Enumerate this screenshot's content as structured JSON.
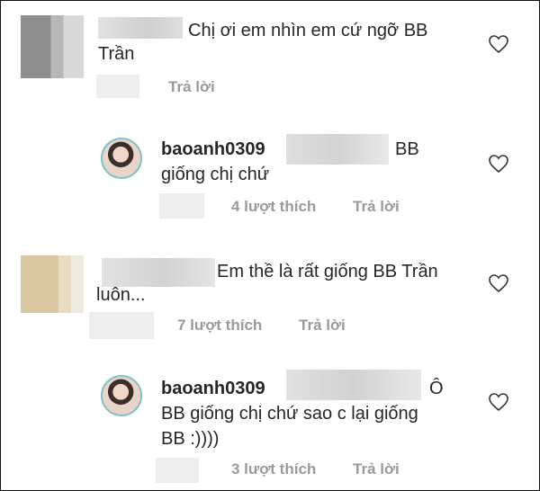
{
  "comments": [
    {
      "text_line1": "Chị ơi em nhìn em cứ ngỡ BB",
      "text_line2": "Trần",
      "reply_label": "Trả lời"
    },
    {
      "username": "baoanh0309",
      "text_line1_end": "BB",
      "text_line2": "giống chị chứ",
      "likes_label": "4 lượt thích",
      "reply_label": "Trả lời"
    },
    {
      "text_line1": "Em thề là rất giống BB Trần",
      "text_line2": "luôn...",
      "likes_label": "7 lượt thích",
      "reply_label": "Trả lời"
    },
    {
      "username": "baoanh0309",
      "text_line1_end": "Ô",
      "text_line2": "BB giống chị chứ sao c lại giống",
      "text_line3": "BB :))))",
      "likes_label": "3 lượt thích",
      "reply_label": "Trả lời"
    }
  ],
  "icons": {
    "like": "heart-outline-icon"
  }
}
